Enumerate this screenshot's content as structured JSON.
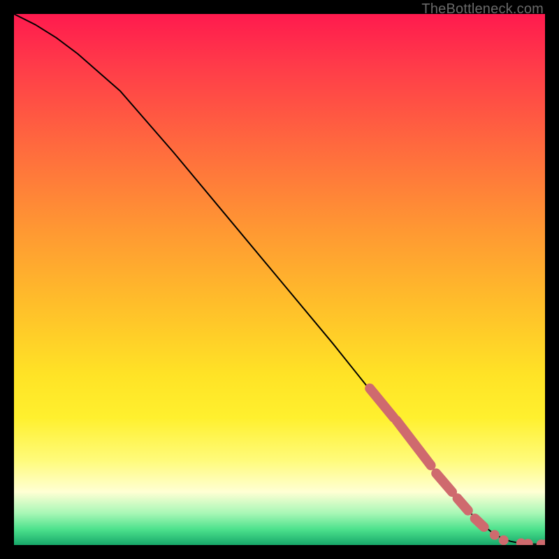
{
  "watermark": "TheBottleneck.com",
  "chart_data": {
    "type": "line",
    "title": "",
    "xlabel": "",
    "ylabel": "",
    "xlim": [
      0,
      100
    ],
    "ylim": [
      0,
      100
    ],
    "series": [
      {
        "name": "curve",
        "x": [
          0,
          4,
          8,
          12,
          16,
          20,
          30,
          40,
          50,
          60,
          68,
          72,
          76,
          80,
          83,
          86,
          88,
          90,
          92,
          93.5,
          95,
          97,
          100
        ],
        "y": [
          100,
          98,
          95.5,
          92.5,
          89,
          85.5,
          74,
          62,
          50,
          38,
          28,
          23,
          18,
          13,
          9.5,
          6,
          4,
          2.4,
          1.2,
          0.7,
          0.4,
          0.2,
          0.1
        ]
      }
    ],
    "highlight_segments": [
      {
        "x0": 67,
        "y0": 29.5,
        "x1": 71.5,
        "y1": 24
      },
      {
        "x0": 72,
        "y0": 23.5,
        "x1": 78.5,
        "y1": 15
      },
      {
        "x0": 79.5,
        "y0": 13.5,
        "x1": 82.5,
        "y1": 10
      },
      {
        "x0": 83.5,
        "y0": 8.8,
        "x1": 85.5,
        "y1": 6.5
      },
      {
        "x0": 86.8,
        "y0": 5,
        "x1": 88.5,
        "y1": 3.4
      }
    ],
    "markers": [
      {
        "x": 90.5,
        "y": 1.9
      },
      {
        "x": 92.2,
        "y": 0.9
      },
      {
        "x": 95.5,
        "y": 0.35
      },
      {
        "x": 96.8,
        "y": 0.25
      },
      {
        "x": 99.3,
        "y": 0.12
      },
      {
        "x": 100,
        "y": 0.1
      }
    ],
    "gradient_bands": [
      {
        "color": "#ff1a4e",
        "stop": 0
      },
      {
        "color": "#ffbf2a",
        "stop": 55
      },
      {
        "color": "#fffb7a",
        "stop": 84
      },
      {
        "color": "#17a86a",
        "stop": 100
      }
    ]
  }
}
